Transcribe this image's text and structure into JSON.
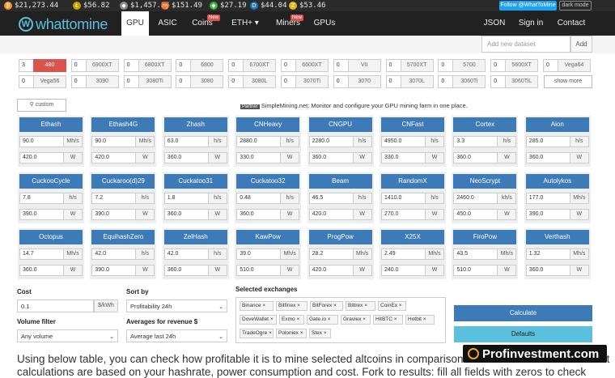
{
  "ticker": [
    {
      "icon": "bitcoin-icon",
      "glyph": "₿",
      "color": "#f7931a",
      "price": "$21,273.44"
    },
    {
      "icon": "litecoin-icon",
      "glyph": "Ł",
      "color": "#c6a000",
      "price": "$56.82"
    },
    {
      "icon": "ethereum-icon",
      "glyph": "◆",
      "color": "#8c8c8c",
      "price": "$1,457.06"
    },
    {
      "icon": "monero-icon",
      "glyph": "ɱ",
      "color": "#f26822",
      "price": "$151.49"
    },
    {
      "icon": "ethereum-classic-icon",
      "glyph": "◆",
      "color": "#3ab83a",
      "price": "$27.19"
    },
    {
      "icon": "dash-icon",
      "glyph": "D",
      "color": "#1c75bc",
      "price": "$44.04"
    },
    {
      "icon": "zcash-icon",
      "glyph": "Z",
      "color": "#e8b30a",
      "price": "$53.46"
    }
  ],
  "follow_label": "Follow @WhatToMine",
  "dark_mode_label": "dark mode",
  "brand": {
    "name": "whattomine",
    "logo_letter": "W",
    "color": "#5bc0de"
  },
  "nav": {
    "items": [
      "GPU",
      "ASIC",
      "Coins",
      "ETH+ ▾",
      "Miners",
      "GPUs"
    ],
    "new_badge": "New",
    "right": [
      "JSON",
      "Sign in",
      "Contact"
    ]
  },
  "dataset": {
    "placeholder": "Add new dataset",
    "add_label": "Add"
  },
  "gpus": [
    {
      "qty": "3",
      "name": "480",
      "selected": true
    },
    {
      "qty": "0",
      "name": "6900XT"
    },
    {
      "qty": "0",
      "name": "6800XT"
    },
    {
      "qty": "0",
      "name": "6800"
    },
    {
      "qty": "0",
      "name": "6700XT"
    },
    {
      "qty": "0",
      "name": "6600XT"
    },
    {
      "qty": "0",
      "name": "VII"
    },
    {
      "qty": "0",
      "name": "5700XT"
    },
    {
      "qty": "0",
      "name": "5700"
    },
    {
      "qty": "0",
      "name": "5600XT"
    },
    {
      "qty": "0",
      "name": "Vega64"
    },
    {
      "qty": "0",
      "name": "Vega56"
    },
    {
      "qty": "0",
      "name": "3090"
    },
    {
      "qty": "0",
      "name": "3080Ti"
    },
    {
      "qty": "0",
      "name": "3080"
    },
    {
      "qty": "0",
      "name": "3080L"
    },
    {
      "qty": "0",
      "name": "3070Ti"
    },
    {
      "qty": "0",
      "name": "3070"
    },
    {
      "qty": "0",
      "name": "3070L"
    },
    {
      "qty": "0",
      "name": "3060Ti"
    },
    {
      "qty": "0",
      "name": "3060TiL"
    }
  ],
  "show_more_label": "show more",
  "custom_label": "custom",
  "partner": {
    "badge": "Partner",
    "text": "SimpleMining.net: Monitor and configure your GPU mining farm in one place."
  },
  "algorithms": [
    {
      "name": "Ethash",
      "hashrate": "90.0",
      "hunit": "Mh/s",
      "power": "420.0",
      "punit": "W"
    },
    {
      "name": "Ethash4G",
      "hashrate": "90.0",
      "hunit": "Mh/s",
      "power": "420.0",
      "punit": "W"
    },
    {
      "name": "Zhash",
      "hashrate": "63.0",
      "hunit": "h/s",
      "power": "360.0",
      "punit": "W"
    },
    {
      "name": "CNHeavy",
      "hashrate": "2880.0",
      "hunit": "h/s",
      "power": "330.0",
      "punit": "W"
    },
    {
      "name": "CNGPU",
      "hashrate": "2280.0",
      "hunit": "h/s",
      "power": "360.0",
      "punit": "W"
    },
    {
      "name": "CNFast",
      "hashrate": "4950.0",
      "hunit": "h/s",
      "power": "330.0",
      "punit": "W"
    },
    {
      "name": "Cortex",
      "hashrate": "3.3",
      "hunit": "h/s",
      "power": "360.0",
      "punit": "W"
    },
    {
      "name": "Aion",
      "hashrate": "285.0",
      "hunit": "h/s",
      "power": "360.0",
      "punit": "W"
    },
    {
      "name": "CuckooCycle",
      "hashrate": "7.8",
      "hunit": "h/s",
      "power": "390.0",
      "punit": "W"
    },
    {
      "name": "Cuckaroo(d)29",
      "hashrate": "7.2",
      "hunit": "h/s",
      "power": "390.0",
      "punit": "W"
    },
    {
      "name": "Cuckatoo31",
      "hashrate": "1.8",
      "hunit": "h/s",
      "power": "360.0",
      "punit": "W"
    },
    {
      "name": "Cuckatoo32",
      "hashrate": "0.48",
      "hunit": "h/s",
      "power": "360.0",
      "punit": "W"
    },
    {
      "name": "Beam",
      "hashrate": "46.5",
      "hunit": "h/s",
      "power": "420.0",
      "punit": "W"
    },
    {
      "name": "RandomX",
      "hashrate": "1410.0",
      "hunit": "h/s",
      "power": "270.0",
      "punit": "W"
    },
    {
      "name": "NeoScrypt",
      "hashrate": "2460.0",
      "hunit": "kh/s",
      "power": "450.0",
      "punit": "W"
    },
    {
      "name": "Autolykos",
      "hashrate": "177.0",
      "hunit": "Mh/s",
      "power": "390.0",
      "punit": "W"
    },
    {
      "name": "Octopus",
      "hashrate": "14.7",
      "hunit": "Mh/s",
      "power": "360.0",
      "punit": "W"
    },
    {
      "name": "EquihashZero",
      "hashrate": "42.0",
      "hunit": "h/s",
      "power": "390.0",
      "punit": "W"
    },
    {
      "name": "ZelHash",
      "hashrate": "42.0",
      "hunit": "h/s",
      "power": "360.0",
      "punit": "W"
    },
    {
      "name": "KawPow",
      "hashrate": "39.0",
      "hunit": "Mh/s",
      "power": "510.0",
      "punit": "W"
    },
    {
      "name": "ProgPow",
      "hashrate": "28.2",
      "hunit": "Mh/s",
      "power": "420.0",
      "punit": "W"
    },
    {
      "name": "X25X",
      "hashrate": "2.49",
      "hunit": "Mh/s",
      "power": "240.0",
      "punit": "W"
    },
    {
      "name": "FiroPow",
      "hashrate": "43.5",
      "hunit": "Mh/s",
      "power": "510.0",
      "punit": "W"
    },
    {
      "name": "Verthash",
      "hashrate": "1.32",
      "hunit": "Mh/s",
      "power": "360.0",
      "punit": "W"
    }
  ],
  "cost": {
    "label": "Cost",
    "value": "0.1",
    "unit": "$/kWh"
  },
  "sort": {
    "label": "Sort by",
    "value": "Profitability 24h"
  },
  "volume": {
    "label": "Volume filter",
    "value": "Any volume"
  },
  "averages": {
    "label": "Averages for revenue $",
    "value": "Average last 24h"
  },
  "exchanges": {
    "label": "Selected exchanges",
    "items": [
      "Binance",
      "Bitfinex",
      "BitForex",
      "Bittrex",
      "CoinEx",
      "DoveWallet",
      "Exmo",
      "Gate.io",
      "Graviex",
      "HitBTC",
      "Hotbit",
      "TradeOgre",
      "Poloniex",
      "Stex"
    ]
  },
  "calculate_label": "Calculate",
  "defaults_label": "Defaults",
  "description": "Using below table, you can check how profitable it is to mine selected altcoins in comparison to ethereum. Please note that",
  "description2": "calculations are based on your hashrate, power consumption and cost. Fork to results: fill all fields with zeros to check",
  "watermark": "Profinvestment.com",
  "colors": {
    "accent": "#3c7ab8",
    "danger": "#d9534f",
    "info": "#5bc0de",
    "nav_bg": "#212121"
  }
}
